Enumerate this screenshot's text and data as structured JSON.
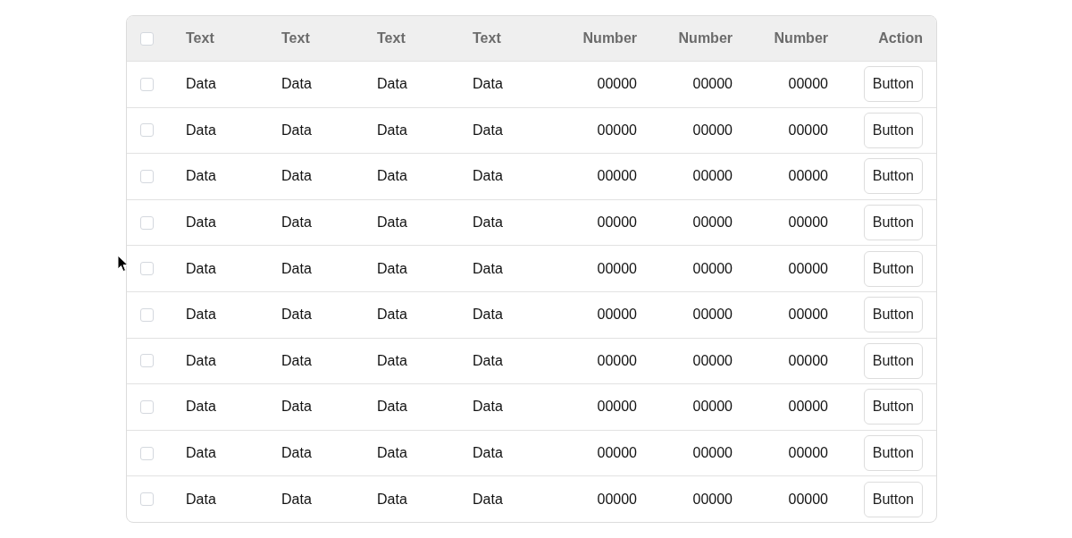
{
  "table": {
    "select_all": {
      "checked": false
    },
    "columns": [
      {
        "label": "Text",
        "kind": "text"
      },
      {
        "label": "Text",
        "kind": "text"
      },
      {
        "label": "Text",
        "kind": "text"
      },
      {
        "label": "Text",
        "kind": "text"
      },
      {
        "label": "Number",
        "kind": "number"
      },
      {
        "label": "Number",
        "kind": "number"
      },
      {
        "label": "Number",
        "kind": "number"
      },
      {
        "label": "Action",
        "kind": "action"
      }
    ],
    "rows": [
      {
        "checked": false,
        "cells": [
          "Data",
          "Data",
          "Data",
          "Data",
          "00000",
          "00000",
          "00000",
          "Button"
        ]
      },
      {
        "checked": false,
        "cells": [
          "Data",
          "Data",
          "Data",
          "Data",
          "00000",
          "00000",
          "00000",
          "Button"
        ]
      },
      {
        "checked": false,
        "cells": [
          "Data",
          "Data",
          "Data",
          "Data",
          "00000",
          "00000",
          "00000",
          "Button"
        ]
      },
      {
        "checked": false,
        "cells": [
          "Data",
          "Data",
          "Data",
          "Data",
          "00000",
          "00000",
          "00000",
          "Button"
        ]
      },
      {
        "checked": false,
        "cells": [
          "Data",
          "Data",
          "Data",
          "Data",
          "00000",
          "00000",
          "00000",
          "Button"
        ]
      },
      {
        "checked": false,
        "cells": [
          "Data",
          "Data",
          "Data",
          "Data",
          "00000",
          "00000",
          "00000",
          "Button"
        ]
      },
      {
        "checked": false,
        "cells": [
          "Data",
          "Data",
          "Data",
          "Data",
          "00000",
          "00000",
          "00000",
          "Button"
        ]
      },
      {
        "checked": false,
        "cells": [
          "Data",
          "Data",
          "Data",
          "Data",
          "00000",
          "00000",
          "00000",
          "Button"
        ]
      },
      {
        "checked": false,
        "cells": [
          "Data",
          "Data",
          "Data",
          "Data",
          "00000",
          "00000",
          "00000",
          "Button"
        ]
      },
      {
        "checked": false,
        "cells": [
          "Data",
          "Data",
          "Data",
          "Data",
          "00000",
          "00000",
          "00000",
          "Button"
        ]
      }
    ]
  }
}
